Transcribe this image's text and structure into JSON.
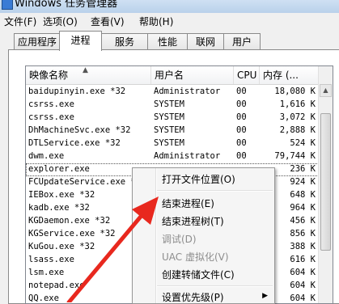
{
  "window": {
    "title": "Windows 任务管理器"
  },
  "menubar": [
    "文件(F)",
    "选项(O)",
    "查看(V)",
    "帮助(H)"
  ],
  "tabs": [
    "应用程序",
    "进程",
    "服务",
    "性能",
    "联网",
    "用户"
  ],
  "active_tab": "进程",
  "columns": {
    "name": "映像名称",
    "user": "用户名",
    "cpu": "CPU",
    "mem": "内存 (..."
  },
  "processes": [
    {
      "name": "baidupinyin.exe *32",
      "user": "Administrator",
      "cpu": "00",
      "mem": "18,080 K"
    },
    {
      "name": "csrss.exe",
      "user": "SYSTEM",
      "cpu": "00",
      "mem": "1,616 K"
    },
    {
      "name": "csrss.exe",
      "user": "SYSTEM",
      "cpu": "00",
      "mem": "3,072 K"
    },
    {
      "name": "DhMachineSvc.exe *32",
      "user": "SYSTEM",
      "cpu": "00",
      "mem": "2,888 K"
    },
    {
      "name": "DTLService.exe *32",
      "user": "SYSTEM",
      "cpu": "00",
      "mem": "524 K"
    },
    {
      "name": "dwm.exe",
      "user": "Administrator",
      "cpu": "00",
      "mem": "79,744 K"
    },
    {
      "name": "explorer.exe",
      "user": "",
      "cpu": "",
      "mem": "236 K"
    },
    {
      "name": "FCUpdateService.exe *",
      "user": "",
      "cpu": "",
      "mem": "924 K"
    },
    {
      "name": "IEBox.exe *32",
      "user": "",
      "cpu": "",
      "mem": "648 K"
    },
    {
      "name": "kadb.exe *32",
      "user": "",
      "cpu": "",
      "mem": "964 K"
    },
    {
      "name": "KGDaemon.exe *32",
      "user": "",
      "cpu": "",
      "mem": "456 K"
    },
    {
      "name": "KGService.exe *32",
      "user": "",
      "cpu": "",
      "mem": "856 K"
    },
    {
      "name": "KuGou.exe *32",
      "user": "",
      "cpu": "",
      "mem": "388 K"
    },
    {
      "name": "lsass.exe",
      "user": "",
      "cpu": "",
      "mem": "616 K"
    },
    {
      "name": "lsm.exe",
      "user": "",
      "cpu": "",
      "mem": "604 K"
    },
    {
      "name": "notepad.exe",
      "user": "",
      "cpu": "",
      "mem": "604 K"
    },
    {
      "name": "QQ.exe",
      "user": "",
      "cpu": "",
      "mem": "604 K"
    }
  ],
  "selected_index": 6,
  "context_menu": {
    "items": [
      {
        "label": "打开文件位置(O)",
        "disabled": false
      },
      {
        "label": "结束进程(E)",
        "disabled": false
      },
      {
        "label": "结束进程树(T)",
        "disabled": false
      },
      {
        "label": "调试(D)",
        "disabled": true
      },
      {
        "label": "UAC 虚拟化(V)",
        "disabled": true
      },
      {
        "label": "创建转储文件(C)",
        "disabled": false
      },
      {
        "label": "设置优先级(P)",
        "disabled": false,
        "submenu": true
      }
    ]
  },
  "colors": {
    "annotation": "#e8281e",
    "selection_outline": "#555555"
  }
}
